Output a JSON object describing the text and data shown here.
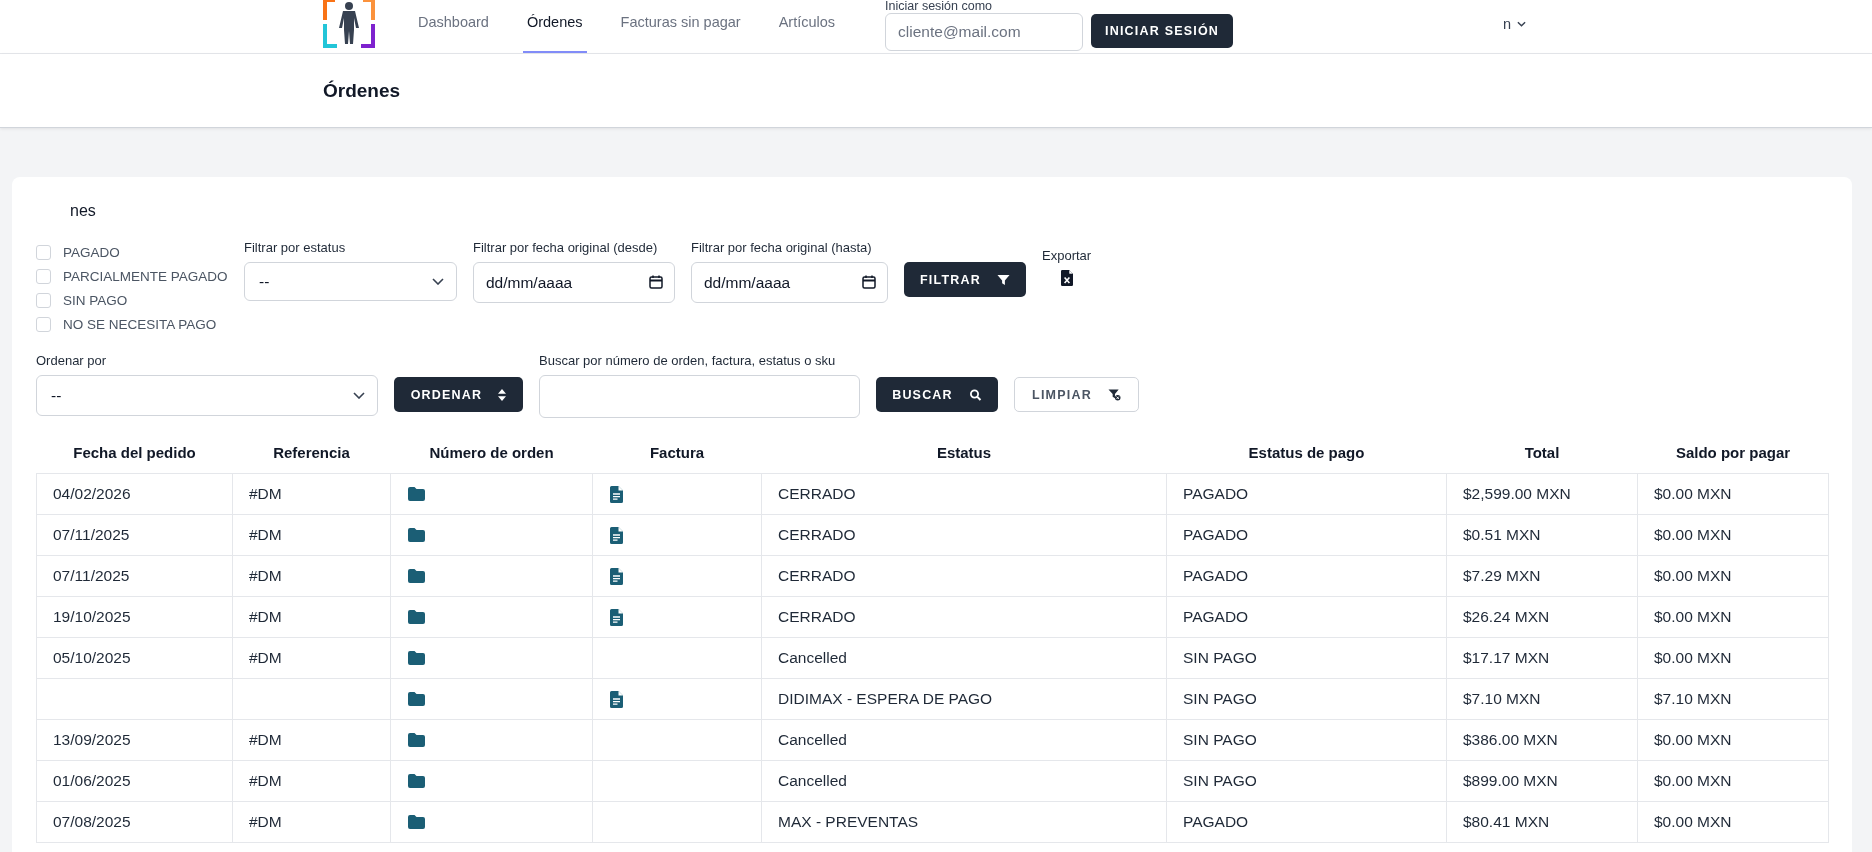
{
  "nav": {
    "tabs": [
      {
        "label": "Dashboard",
        "selected": false
      },
      {
        "label": "Órdenes",
        "selected": true
      },
      {
        "label": "Facturas sin pagar",
        "selected": false
      },
      {
        "label": "Artículos",
        "selected": false
      }
    ],
    "login": {
      "label": "Iniciar sesión como",
      "email_placeholder": "cliente@mail.com",
      "button": "INICIAR SESIÓN"
    },
    "user_menu": {
      "label": "n"
    }
  },
  "page_title": "Órdenes",
  "card": {
    "title": "nes",
    "payment_filters": [
      {
        "label": "PAGADO",
        "checked": false
      },
      {
        "label": "PARCIALMENTE PAGADO",
        "checked": false
      },
      {
        "label": "SIN PAGO",
        "checked": false
      },
      {
        "label": "NO SE NECESITA PAGO",
        "checked": false
      }
    ],
    "status_filter": {
      "label": "Filtrar por estatus",
      "value": "--"
    },
    "date_from": {
      "label": "Filtrar por fecha original (desde)",
      "placeholder": "dd/mm/aaaa"
    },
    "date_to": {
      "label": "Filtrar por fecha original (hasta)",
      "placeholder": "dd/mm/aaaa"
    },
    "filter_button": "FILTRAR",
    "export": {
      "label": "Exportar"
    },
    "sort": {
      "label": "Ordenar por",
      "value": "--"
    },
    "sort_button": "ORDENAR",
    "search": {
      "label": "Buscar por número de orden, factura, estatus o sku"
    },
    "search_button": "BUSCAR",
    "clear_button": "LIMPIAR"
  },
  "table": {
    "columns": [
      "Fecha del pedido",
      "Referencia",
      "Número de orden",
      "Factura",
      "Estatus",
      "Estatus de pago",
      "Total",
      "Saldo por pagar"
    ],
    "rows": [
      {
        "date": "04/02/2026",
        "reference": "#DM",
        "has_invoice": true,
        "status": "CERRADO",
        "payment_status": "PAGADO",
        "total": "$2,599.00 MXN",
        "balance": "$0.00 MXN"
      },
      {
        "date": "07/11/2025",
        "reference": "#DM",
        "has_invoice": true,
        "status": "CERRADO",
        "payment_status": "PAGADO",
        "total": "$0.51 MXN",
        "balance": "$0.00 MXN"
      },
      {
        "date": "07/11/2025",
        "reference": "#DM",
        "has_invoice": true,
        "status": "CERRADO",
        "payment_status": "PAGADO",
        "total": "$7.29 MXN",
        "balance": "$0.00 MXN"
      },
      {
        "date": "19/10/2025",
        "reference": "#DM",
        "has_invoice": true,
        "status": "CERRADO",
        "payment_status": "PAGADO",
        "total": "$26.24 MXN",
        "balance": "$0.00 MXN"
      },
      {
        "date": "05/10/2025",
        "reference": "#DM",
        "has_invoice": false,
        "status": "Cancelled",
        "payment_status": "SIN PAGO",
        "total": "$17.17 MXN",
        "balance": "$0.00 MXN"
      },
      {
        "has_invoice": true,
        "status": "DIDIMAX - ESPERA DE PAGO",
        "payment_status": "SIN PAGO",
        "total": "$7.10 MXN",
        "balance": "$7.10 MXN"
      },
      {
        "date": "13/09/2025",
        "reference": "#DM",
        "has_invoice": false,
        "status": "Cancelled",
        "payment_status": "SIN PAGO",
        "total": "$386.00 MXN",
        "balance": "$0.00 MXN"
      },
      {
        "date": "01/06/2025",
        "reference": "#DM",
        "has_invoice": false,
        "status": "Cancelled",
        "payment_status": "SIN PAGO",
        "total": "$899.00 MXN",
        "balance": "$0.00 MXN"
      },
      {
        "date": "07/08/2025",
        "reference": "#DM",
        "has_invoice": false,
        "status": "MAX - PREVENTAS",
        "payment_status": "PAGADO",
        "total": "$80.41 MXN",
        "balance": "$0.00 MXN"
      }
    ]
  }
}
